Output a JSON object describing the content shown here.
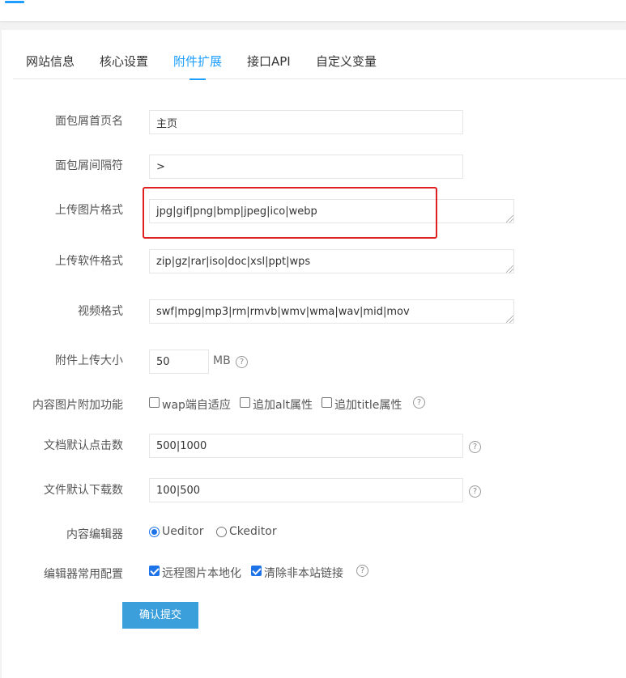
{
  "tabs": [
    {
      "label": "网站信息",
      "active": false
    },
    {
      "label": "核心设置",
      "active": false
    },
    {
      "label": "附件扩展",
      "active": true
    },
    {
      "label": "接口API",
      "active": false
    },
    {
      "label": "自定义变量",
      "active": false
    }
  ],
  "fields": {
    "breadcrumb_home": {
      "label": "面包屑首页名",
      "value": "主页"
    },
    "breadcrumb_sep": {
      "label": "面包屑间隔符",
      "value": ">"
    },
    "upload_image_formats": {
      "label": "上传图片格式",
      "value": "jpg|gif|png|bmp|jpeg|ico|webp"
    },
    "upload_software_formats": {
      "label": "上传软件格式",
      "value": "zip|gz|rar|iso|doc|xsl|ppt|wps"
    },
    "video_formats": {
      "label": "视频格式",
      "value": "swf|mpg|mp3|rm|rmvb|wmv|wma|wav|mid|mov"
    },
    "upload_size": {
      "label": "附件上传大小",
      "value": "50",
      "unit": "MB"
    },
    "content_image_extra": {
      "label": "内容图片附加功能",
      "options": [
        {
          "label": "wap端自适应",
          "checked": false
        },
        {
          "label": "追加alt属性",
          "checked": false
        },
        {
          "label": "追加title属性",
          "checked": false
        }
      ]
    },
    "doc_default_clicks": {
      "label": "文档默认点击数",
      "value": "500|1000"
    },
    "file_default_downloads": {
      "label": "文件默认下载数",
      "value": "100|500"
    },
    "content_editor": {
      "label": "内容编辑器",
      "options": [
        {
          "label": "Ueditor",
          "checked": true
        },
        {
          "label": "Ckeditor",
          "checked": false
        }
      ]
    },
    "editor_common_config": {
      "label": "编辑器常用配置",
      "options": [
        {
          "label": "远程图片本地化",
          "checked": true
        },
        {
          "label": "清除非本站链接",
          "checked": true
        }
      ]
    }
  },
  "help_glyph": "?",
  "submit_label": "确认提交",
  "colors": {
    "accent": "#1e9fff",
    "button": "#3a9fdb",
    "highlight": "#e02020",
    "checkbox": "#1e73e8"
  }
}
